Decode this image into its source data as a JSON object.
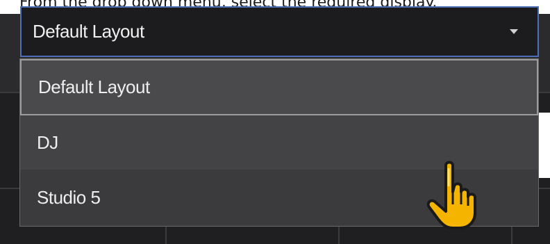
{
  "instruction": "From the drop down menu, select the required display.",
  "dropdown": {
    "selected": "Default Layout",
    "caret_icon": "caret-down-icon",
    "options": [
      {
        "label": "Default Layout"
      },
      {
        "label": "DJ"
      },
      {
        "label": "Studio 5"
      }
    ]
  },
  "pointer_icon": "hand-pointer-icon",
  "colors": {
    "app_background": "#1f1f21",
    "select_border": "#4d6fb8",
    "menu_background": "#434345",
    "selected_option_border": "#9c9c9e",
    "pointer": "#f5b400"
  }
}
